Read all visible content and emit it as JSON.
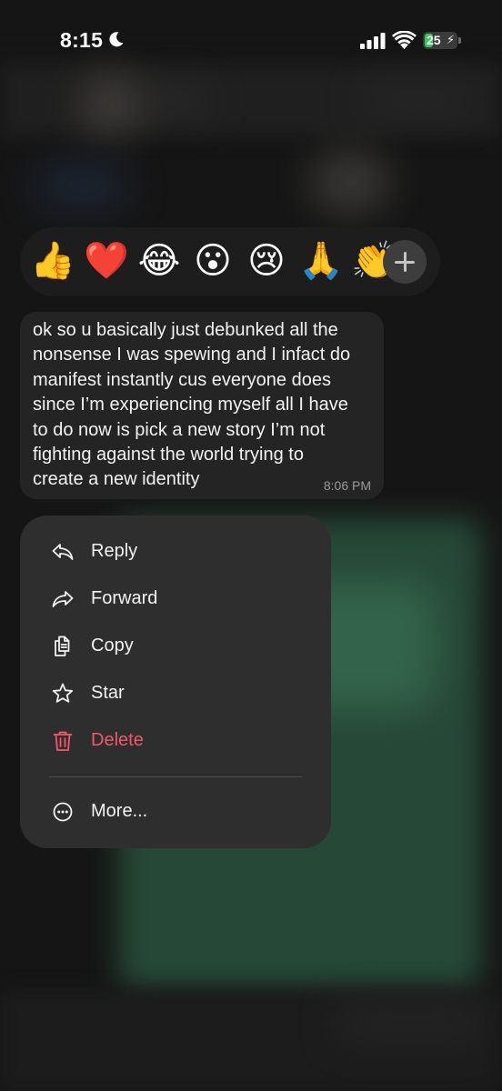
{
  "status_bar": {
    "time": "8:15",
    "battery": "25",
    "battery_level": 0.25
  },
  "reactions": [
    {
      "emoji": "👍",
      "name": "thumbs-up"
    },
    {
      "emoji": "❤️",
      "name": "heart"
    },
    {
      "emoji": "😂",
      "name": "tears-of-joy"
    },
    {
      "emoji": "😮",
      "name": "surprised"
    },
    {
      "emoji": "😢",
      "name": "crying"
    },
    {
      "emoji": "🙏",
      "name": "folded-hands"
    },
    {
      "emoji": "👏",
      "name": "clapping-hands"
    }
  ],
  "message": {
    "text": "ok so u basically just debunked all the\nnonsense I was spewing and I infact do\nmanifest instantly cus everyone does\nsince I’m experiencing myself all I have\nto do now is pick a new story I’m not\nfighting against the world trying to\ncreate a new identity",
    "time": "8:06 PM"
  },
  "menu": {
    "reply": "Reply",
    "forward": "Forward",
    "copy": "Copy",
    "star": "Star",
    "delete": "Delete",
    "more": "More..."
  },
  "colors": {
    "danger": "#f0596a",
    "battery_fill": "#34c759"
  }
}
